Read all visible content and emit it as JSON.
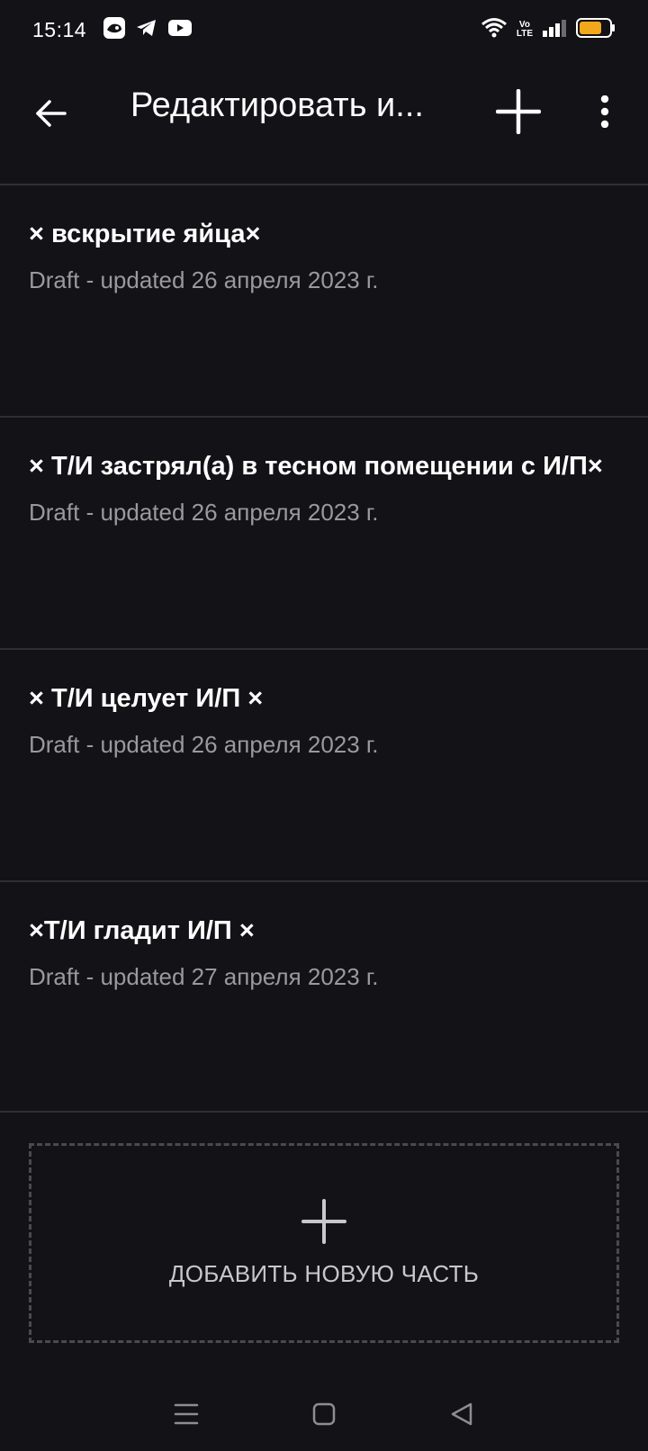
{
  "status_bar": {
    "time": "15:14",
    "apps": [
      "game-app-icon",
      "telegram-icon",
      "youtube-icon"
    ],
    "volte_top": "Vo",
    "volte_bottom": "LTE",
    "battery_color": "#F2A81D"
  },
  "app_bar": {
    "title": "Редактировать и..."
  },
  "parts": [
    {
      "title": "× вскрытие яйца×",
      "meta": "Draft - updated 26 апреля 2023 г."
    },
    {
      "title": "× Т/И застрял(а) в тесном помещении с И/П×",
      "meta": "Draft - updated 26 апреля 2023 г."
    },
    {
      "title": "× Т/И целует И/П ×",
      "meta": "Draft - updated 26 апреля 2023 г."
    },
    {
      "title": "×Т/И гладит И/П ×",
      "meta": "Draft - updated 27 апреля 2023 г."
    }
  ],
  "add_part": {
    "label": "ДОБАВИТЬ НОВУЮ ЧАСТЬ"
  },
  "colors": {
    "background": "#131216",
    "divider": "#2F2E33",
    "meta_text": "#9A999E"
  }
}
